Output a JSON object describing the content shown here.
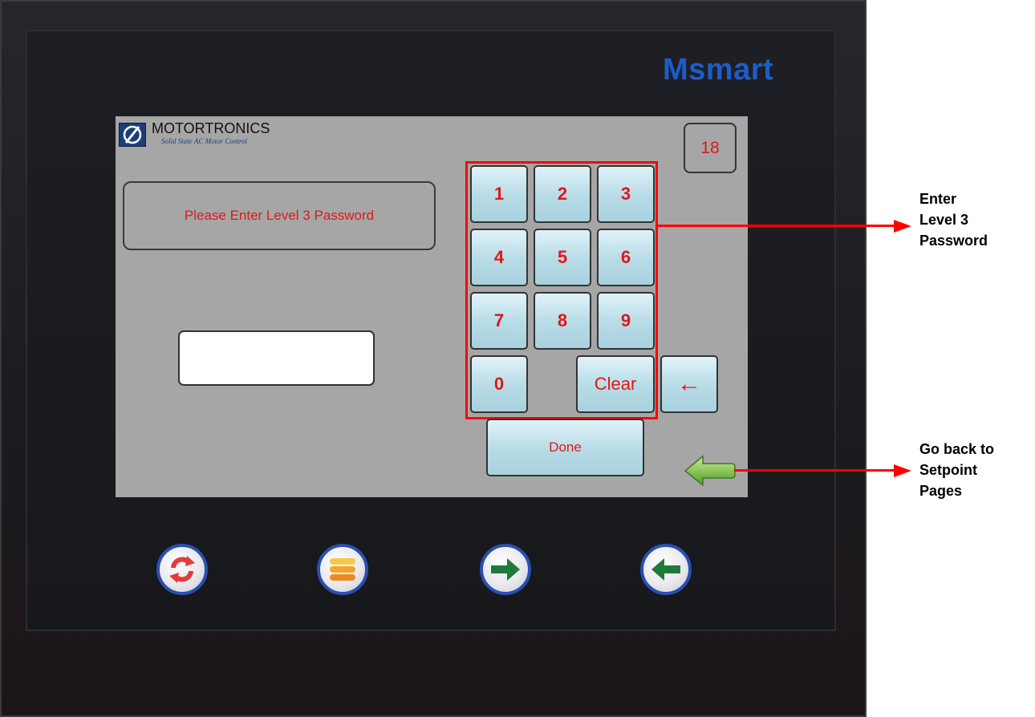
{
  "device": {
    "brand": "Msmart"
  },
  "screen": {
    "logo": {
      "name": "MOTORTRONICS",
      "tagline": "Solid State AC Motor Control"
    },
    "prompt": "Please Enter Level 3 Password",
    "password_value": "",
    "page_number": "18",
    "keypad": {
      "keys": [
        "1",
        "2",
        "3",
        "4",
        "5",
        "6",
        "7",
        "8",
        "9",
        "0"
      ],
      "clear_label": "Clear",
      "backspace_label": "←",
      "done_label": "Done"
    }
  },
  "annotations": {
    "keypad_note": [
      "Enter",
      "Level 3",
      "Password"
    ],
    "back_note": [
      "Go back to",
      "Setpoint",
      "Pages"
    ]
  },
  "colors": {
    "accent_text": "#e01818",
    "screen_bg": "#a6a6a6",
    "key_bg": "#b7dbe6",
    "annotation": "#ff0000",
    "brand": "#1e5cc8"
  },
  "icons": {
    "hardware_buttons": [
      "refresh-icon",
      "menu-icon",
      "arrow-right-icon",
      "arrow-left-icon"
    ],
    "screen_back": "green-back-arrow-icon"
  }
}
